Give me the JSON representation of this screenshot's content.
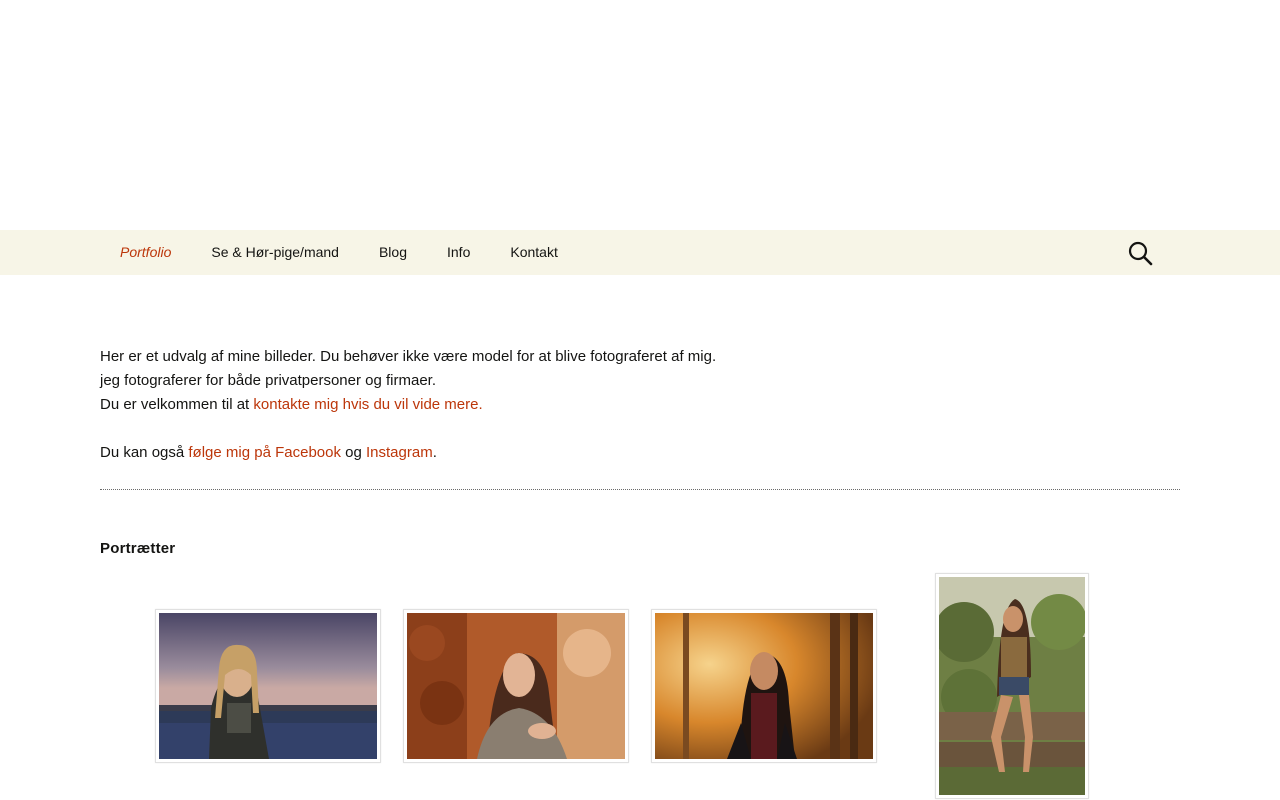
{
  "nav": {
    "items": [
      {
        "label": "Portfolio",
        "current": true
      },
      {
        "label": "Se & Hør-pige/mand",
        "current": false
      },
      {
        "label": "Blog",
        "current": false
      },
      {
        "label": "Info",
        "current": false
      },
      {
        "label": "Kontakt",
        "current": false
      }
    ],
    "search_icon": "search-icon"
  },
  "intro": {
    "line1": "Her er et udvalg af mine billeder. Du behøver ikke være model for at blive fotograferet af mig.",
    "line2": "jeg fotograferer for både privatpersoner og firmaer.",
    "line3_prefix": "Du er velkommen til at ",
    "line3_link": "kontakte mig hvis du vil vide mere.",
    "follow_prefix": "Du kan også ",
    "facebook_link": "følge mig på Facebook",
    "follow_and": " og ",
    "instagram_link": "Instagram",
    "follow_suffix": "."
  },
  "gallery": {
    "title": "Portrætter"
  },
  "colors": {
    "accent": "#bc360a",
    "nav_background": "#f7f5e7",
    "text": "#141412"
  }
}
